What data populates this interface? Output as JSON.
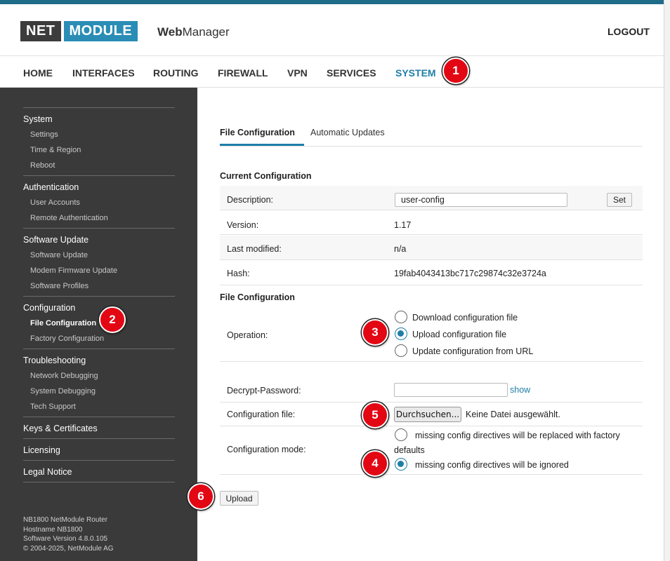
{
  "colors": {
    "accent": "#1f7ea8",
    "sidebar_bg": "#3a3a3a",
    "badge_red": "#e30613",
    "logo_dark": "#3c3c3c",
    "logo_blue": "#2a8db5"
  },
  "header": {
    "logo_net": "NET",
    "logo_module": "MODULE",
    "app_name_bold": "Web",
    "app_name_rest": "Manager",
    "logout_label": "LOGOUT"
  },
  "nav": {
    "items": [
      {
        "label": "HOME",
        "active": false
      },
      {
        "label": "INTERFACES",
        "active": false
      },
      {
        "label": "ROUTING",
        "active": false
      },
      {
        "label": "FIREWALL",
        "active": false
      },
      {
        "label": "VPN",
        "active": false
      },
      {
        "label": "SERVICES",
        "active": false
      },
      {
        "label": "SYSTEM",
        "active": true
      }
    ]
  },
  "badges": [
    "1",
    "2",
    "3",
    "4",
    "5",
    "6"
  ],
  "sidebar": {
    "groups": [
      {
        "label": "System",
        "items": [
          "Settings",
          "Time & Region",
          "Reboot"
        ]
      },
      {
        "label": "Authentication",
        "items": [
          "User Accounts",
          "Remote Authentication"
        ]
      },
      {
        "label": "Software Update",
        "items": [
          "Software Update",
          "Modem Firmware Update",
          "Software Profiles"
        ]
      },
      {
        "label": "Configuration",
        "items": [
          "File Configuration",
          "Factory Configuration"
        ],
        "active_item": "File Configuration"
      },
      {
        "label": "Troubleshooting",
        "items": [
          "Network Debugging",
          "System Debugging",
          "Tech Support"
        ]
      },
      {
        "label": "Keys & Certificates",
        "items": []
      },
      {
        "label": "Licensing",
        "items": []
      },
      {
        "label": "Legal Notice",
        "items": []
      }
    ],
    "footer": {
      "line1": "NB1800 NetModule Router",
      "line2": "Hostname NB1800",
      "line3": "Software Version 4.8.0.105",
      "line4": "© 2004-2025, NetModule AG"
    }
  },
  "tabs": [
    {
      "label": "File Configuration",
      "active": true
    },
    {
      "label": "Automatic Updates",
      "active": false
    }
  ],
  "current_config": {
    "title": "Current Configuration",
    "description_label": "Description:",
    "description_value": "user-config",
    "set_label": "Set",
    "version_label": "Version:",
    "version_value": "1.17",
    "modified_label": "Last modified:",
    "modified_value": "n/a",
    "hash_label": "Hash:",
    "hash_value": "19fab4043413bc717c29874c32e3724a"
  },
  "file_config": {
    "title": "File Configuration",
    "operation_label": "Operation:",
    "operations": [
      {
        "label": "Download configuration file",
        "checked": false
      },
      {
        "label": "Upload configuration file",
        "checked": true
      },
      {
        "label": "Update configuration from URL",
        "checked": false
      }
    ],
    "decrypt_label": "Decrypt-Password:",
    "decrypt_value": "",
    "show_label": "show",
    "file_label": "Configuration file:",
    "browse_label": "Durchsuchen...",
    "file_status": "Keine Datei ausgewählt.",
    "mode_label": "Configuration mode:",
    "mode_option1_line1": "missing config directives will be replaced with factory",
    "mode_option1_line2": "defaults",
    "mode_option1_checked": false,
    "mode_option2": "missing config directives will be ignored",
    "mode_option2_checked": true,
    "upload_label": "Upload"
  }
}
